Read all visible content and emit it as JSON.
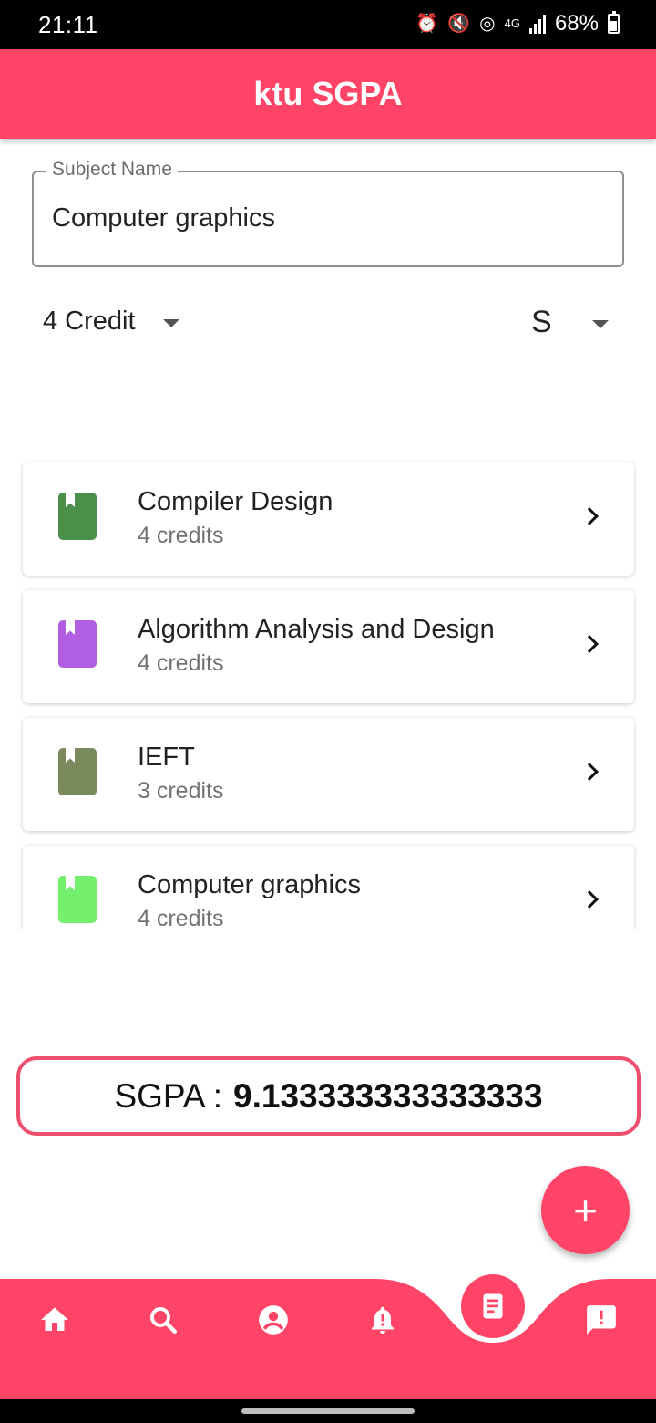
{
  "status_bar": {
    "time": "21:11",
    "battery": "68%",
    "network": "4G"
  },
  "app_bar": {
    "title": "ktu SGPA"
  },
  "subject_field": {
    "label": "Subject Name",
    "value": "Computer graphics"
  },
  "credit_select": {
    "value": "4 Credit"
  },
  "grade_select": {
    "value": "S"
  },
  "subjects": [
    {
      "name": "Compiler Design",
      "credits": "4 credits",
      "color": "#4a8f4a"
    },
    {
      "name": "Algorithm Analysis and Design",
      "credits": "4 credits",
      "color": "#b15fe2"
    },
    {
      "name": "IEFT",
      "credits": "3 credits",
      "color": "#7b8a5c"
    },
    {
      "name": "Computer graphics",
      "credits": "4 credits",
      "color": "#75ef6e"
    }
  ],
  "sgpa": {
    "label": "SGPA :",
    "value": "9.133333333333333"
  },
  "fab": {
    "icon": "plus-icon",
    "symbol": "+"
  },
  "bottom_nav": {
    "items": [
      "home-icon",
      "search-icon",
      "account-icon",
      "notification-icon",
      "document-icon",
      "feedback-icon"
    ],
    "active": "document-icon",
    "color": "#ff4468"
  }
}
